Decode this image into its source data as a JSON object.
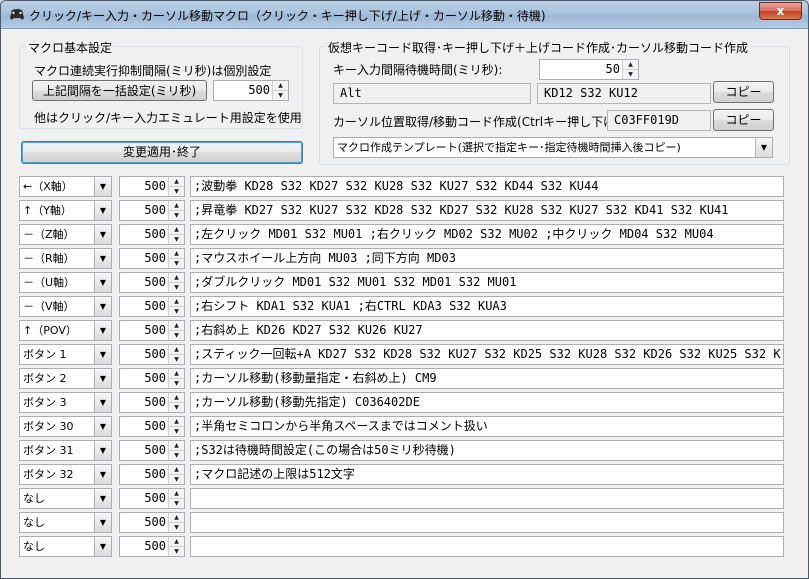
{
  "window": {
    "title": "クリック/キー入力・カーソル移動マクロ（クリック・キー押し下げ/上げ・カーソル移動・待機)",
    "close_label": "x"
  },
  "macro_settings": {
    "legend": "マクロ基本設定",
    "interval_note": "マクロ連続実行抑制間隔(ミリ秒)は個別設定",
    "bulk_button": "上記間隔を一括設定(ミリ秒)",
    "bulk_value": "500",
    "other_note": "他はクリック/キー入力エミュレート用設定を使用"
  },
  "apply_button": "変更適用･終了",
  "virtual_key": {
    "legend": "仮想キーコード取得･キー押し下げ＋上げコード作成･カーソル移動コード作成",
    "interval_label": "キー入力間隔待機時間(ミリ秒):",
    "interval_value": "50",
    "key_name": "Alt",
    "key_code": "KD12 S32 KU12",
    "copy_label": "コピー",
    "cursor_label": "カーソル位置取得/移動コード作成(Ctrlキー押し下げ):",
    "cursor_code": "C03FF019D",
    "copy_label2": "コピー",
    "template": "マクロ作成テンプレート(選択で指定キー･指定待機時間挿入後コピー)"
  },
  "rows": [
    {
      "key": "←（X軸）",
      "interval": "500",
      "macro": ";波動拳 KD28 S32 KD27 S32 KU28 S32 KU27 S32 KD44 S32 KU44"
    },
    {
      "key": "↑（Y軸）",
      "interval": "500",
      "macro": ";昇竜拳 KD27 S32 KU27 S32 KD28 S32 KD27 S32 KU28 S32 KU27 S32 KD41 S32 KU41"
    },
    {
      "key": "－（Z軸）",
      "interval": "500",
      "macro": ";左クリック MD01 S32 MU01 ;右クリック MD02 S32 MU02 ;中クリック MD04 S32 MU04"
    },
    {
      "key": "－（R軸）",
      "interval": "500",
      "macro": ";マウスホイール上方向 MU03 ;同下方向 MD03"
    },
    {
      "key": "－（U軸）",
      "interval": "500",
      "macro": ";ダブルクリック MD01 S32 MU01 S32 MD01 S32 MU01"
    },
    {
      "key": "－（V軸）",
      "interval": "500",
      "macro": ";右シフト KDA1 S32 KUA1 ;右CTRL KDA3 S32 KUA3"
    },
    {
      "key": "↑（POV）",
      "interval": "500",
      "macro": ";右斜め上 KD26 KD27 S32 KU26 KU27"
    },
    {
      "key": "ボタン 1",
      "interval": "500",
      "macro": ";スティック一回転+A KD27 S32 KD28 S32 KU27 S32 KD25 S32 KU28 S32 KD26 S32 KU25 S32 K"
    },
    {
      "key": "ボタン 2",
      "interval": "500",
      "macro": ";カーソル移動(移動量指定・右斜め上) CM9"
    },
    {
      "key": "ボタン 3",
      "interval": "500",
      "macro": ";カーソル移動(移動先指定) C036402DE"
    },
    {
      "key": "ボタン 30",
      "interval": "500",
      "macro": ";半角セミコロンから半角スペースまではコメント扱い"
    },
    {
      "key": "ボタン 31",
      "interval": "500",
      "macro": ";S32は待機時間設定(この場合は50ミリ秒待機)"
    },
    {
      "key": "ボタン 32",
      "interval": "500",
      "macro": ";マクロ記述の上限は512文字"
    },
    {
      "key": "なし",
      "interval": "500",
      "macro": ""
    },
    {
      "key": "なし",
      "interval": "500",
      "macro": ""
    },
    {
      "key": "なし",
      "interval": "500",
      "macro": ""
    }
  ],
  "icons": {
    "app": "gamepad-icon",
    "dropdown": "chevron-down-icon",
    "spin_up": "spin-up-icon",
    "spin_down": "spin-down-icon",
    "close": "close-icon"
  }
}
